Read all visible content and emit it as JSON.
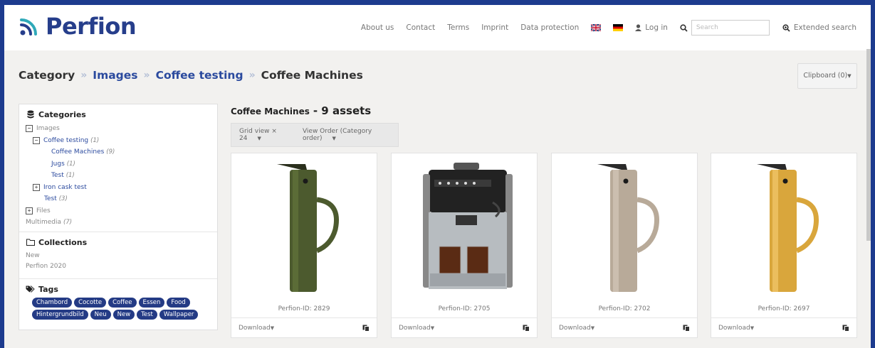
{
  "header": {
    "logo_text": "Perfion",
    "nav": [
      "About us",
      "Contact",
      "Terms",
      "Imprint",
      "Data protection"
    ],
    "login": "Log in",
    "search_placeholder": "Search",
    "extended_search": "Extended search"
  },
  "breadcrumb": {
    "items": [
      "Category",
      "Images",
      "Coffee testing",
      "Coffee Machines"
    ],
    "separator": "»"
  },
  "clipboard": "Clipboard (0)",
  "sidebar": {
    "categories_title": "Categories",
    "tree": [
      {
        "label": "Images",
        "count": ""
      },
      {
        "label": "Coffee testing",
        "count": "(1)"
      },
      {
        "label": "Coffee Machines",
        "count": "(9)"
      },
      {
        "label": "Jugs",
        "count": "(1)"
      },
      {
        "label": "Test",
        "count": "(1)"
      },
      {
        "label": "Iron cask test",
        "count": ""
      },
      {
        "label": "Test",
        "count": "(3)"
      },
      {
        "label": "Files",
        "count": ""
      },
      {
        "label": "Multimedia",
        "count": "(7)"
      }
    ],
    "collections_title": "Collections",
    "collections": [
      "New",
      "Perfion 2020"
    ],
    "tags_title": "Tags",
    "tags": [
      "Chambord",
      "Cocotte",
      "Coffee",
      "Essen",
      "Food",
      "Hintergrundbild",
      "Neu",
      "New",
      "Test",
      "Wallpaper"
    ]
  },
  "content": {
    "title": "Coffee Machines",
    "asset_count": "- 9 assets",
    "grid_view": "Grid view × 24",
    "view_order": "View Order (Category order)"
  },
  "cards": [
    {
      "pid": "Perfion-ID: 2829",
      "download": "Download",
      "color": "#4b5a2f"
    },
    {
      "pid": "Perfion-ID: 2705",
      "download": "Download",
      "color": "#3a3a3a"
    },
    {
      "pid": "Perfion-ID: 2702",
      "download": "Download",
      "color": "#b9ab9a"
    },
    {
      "pid": "Perfion-ID: 2697",
      "download": "Download",
      "color": "#d7a53c"
    }
  ],
  "colors": {
    "brand": "#263e8b",
    "link": "#2b4a9e",
    "tag": "#243b85"
  }
}
